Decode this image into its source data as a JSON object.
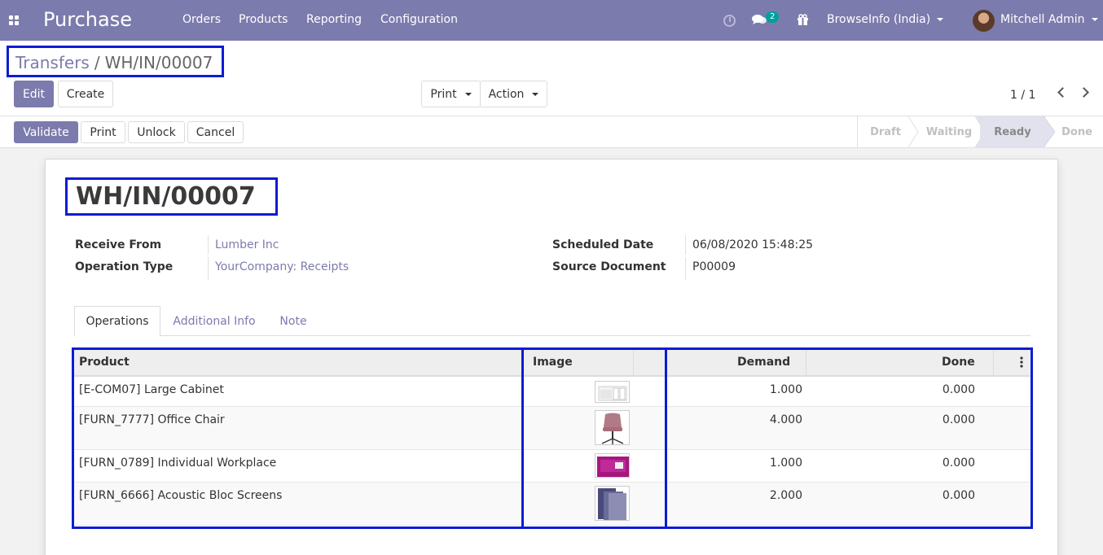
{
  "navbar": {
    "app_name": "Purchase",
    "menu": [
      "Orders",
      "Products",
      "Reporting",
      "Configuration"
    ],
    "message_count": "2",
    "company": "BrowseInfo (India)",
    "user": "Mitchell Admin"
  },
  "breadcrumb": {
    "parent": "Transfers",
    "separator": "/",
    "current": "WH/IN/00007"
  },
  "toolbar": {
    "edit": "Edit",
    "create": "Create",
    "print": "Print",
    "action": "Action",
    "pager": "1 / 1"
  },
  "statusbar": {
    "buttons": {
      "validate": "Validate",
      "print": "Print",
      "unlock": "Unlock",
      "cancel": "Cancel"
    },
    "stages": [
      "Draft",
      "Waiting",
      "Ready",
      "Done"
    ],
    "active_stage": "Ready"
  },
  "record": {
    "name": "WH/IN/00007",
    "fields": {
      "receive_from_label": "Receive From",
      "receive_from": "Lumber Inc",
      "operation_type_label": "Operation Type",
      "operation_type": "YourCompany: Receipts",
      "scheduled_date_label": "Scheduled Date",
      "scheduled_date": "06/08/2020 15:48:25",
      "source_document_label": "Source Document",
      "source_document": "P00009"
    }
  },
  "tabs": [
    "Operations",
    "Additional Info",
    "Note"
  ],
  "operations": {
    "columns": {
      "product": "Product",
      "image": "Image",
      "demand": "Demand",
      "done": "Done"
    },
    "rows": [
      {
        "product": "[E-COM07] Large Cabinet",
        "demand": "1.000",
        "done": "0.000",
        "image": "cabinet"
      },
      {
        "product": "[FURN_7777] Office Chair",
        "demand": "4.000",
        "done": "0.000",
        "image": "chair"
      },
      {
        "product": "[FURN_0789] Individual Workplace",
        "demand": "1.000",
        "done": "0.000",
        "image": "workplace"
      },
      {
        "product": "[FURN_6666] Acoustic Bloc Screens",
        "demand": "2.000",
        "done": "0.000",
        "image": "screens"
      }
    ]
  },
  "colors": {
    "brand": "#7c7bad",
    "highlight": "#0b1cd1",
    "badge": "#00a09d"
  }
}
